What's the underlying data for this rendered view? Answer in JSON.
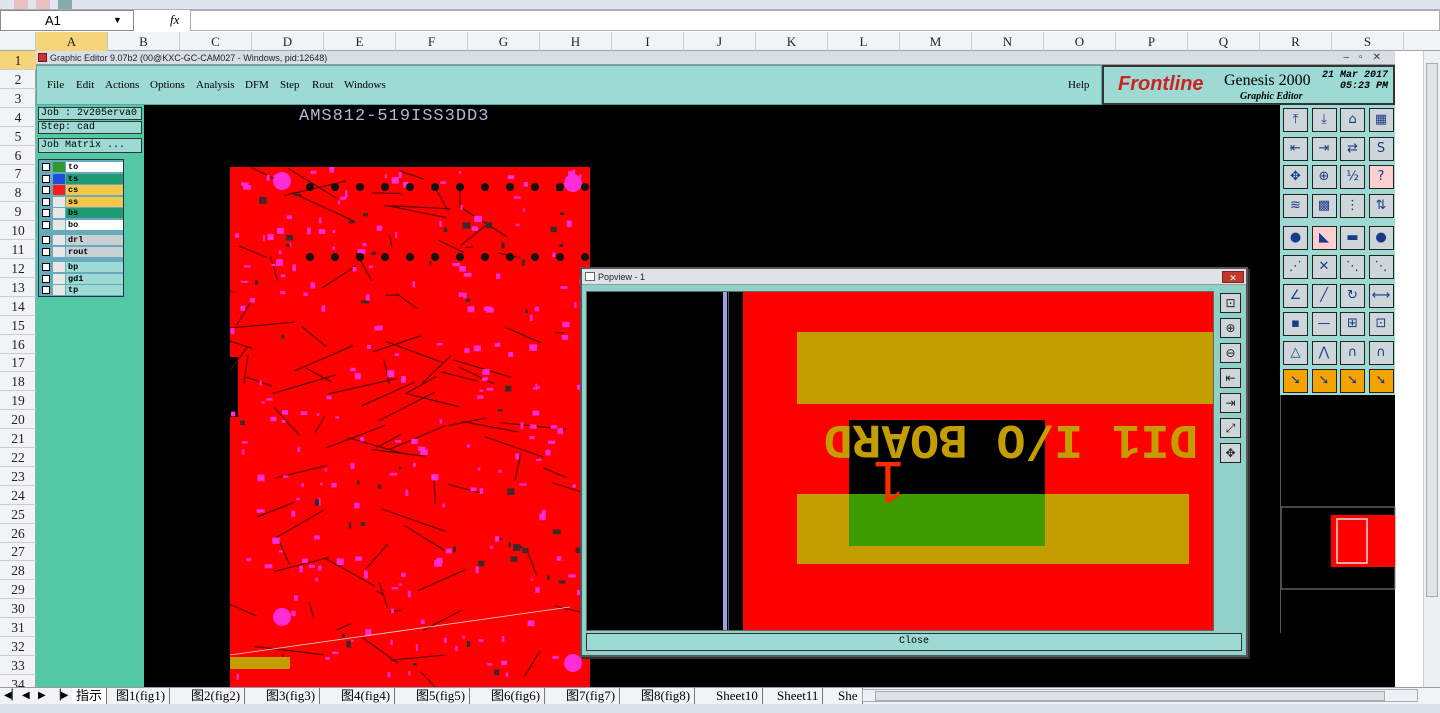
{
  "spreadsheet": {
    "name_box": "A1",
    "formula_symbol": "fx",
    "columns": [
      "A",
      "B",
      "C",
      "D",
      "E",
      "F",
      "G",
      "H",
      "I",
      "J",
      "K",
      "L",
      "M",
      "N",
      "O",
      "P",
      "Q",
      "R",
      "S"
    ],
    "rows": [
      "1",
      "2",
      "3",
      "4",
      "5",
      "6",
      "7",
      "8",
      "9",
      "10",
      "11",
      "12",
      "13",
      "14",
      "15",
      "16",
      "17",
      "18",
      "19",
      "20",
      "21",
      "22",
      "23",
      "24",
      "25",
      "26",
      "27",
      "28",
      "29",
      "30",
      "31",
      "32",
      "33",
      "34"
    ],
    "sheet_tabs": [
      "指示",
      "图1(fig1)",
      "图2(fig2)",
      "图3(fig3)",
      "图4(fig4)",
      "图5(fig5)",
      "图6(fig6)",
      "图7(fig7)",
      "图8(fig8)",
      "Sheet10",
      "Sheet11",
      "She"
    ]
  },
  "app": {
    "window_title": "Graphic Editor 9.07b2 (00@KXC-GC-CAM027 - Windows, pid:12648)",
    "menus": [
      "File",
      "Edit",
      "Actions",
      "Options",
      "Analysis",
      "DFM",
      "Step",
      "Rout",
      "Windows"
    ],
    "help": "Help",
    "brand": {
      "logo": "Frontline",
      "product": "Genesis 2000",
      "subtitle": "Graphic Editor",
      "date": "21 Mar 2017",
      "time": "05:23 PM"
    },
    "job_label": "Job : 2v205erva0",
    "step_label": "Step: cad",
    "job_matrix": "Job Matrix ...",
    "layers": [
      {
        "name": "to",
        "color": "#2e9a2e",
        "bg": "#ffffff"
      },
      {
        "name": "ts",
        "color": "#1f4fd6",
        "bg": "#1f9a73"
      },
      {
        "name": "cs",
        "color": "#ff1a1a",
        "bg": "#f3c84a"
      },
      {
        "name": "ss",
        "color": "#e7e7e7",
        "bg": "#f3c84a"
      },
      {
        "name": "bs",
        "color": "#e7e7e7",
        "bg": "#1f9a73"
      },
      {
        "name": "bo",
        "color": "#e7e7e7",
        "bg": "#ffffff"
      },
      {
        "name": "drl",
        "color": "#e7e7e7",
        "bg": "#c7d1d4"
      },
      {
        "name": "rout",
        "color": "#e7e7e7",
        "bg": "#c7d1d4"
      },
      {
        "name": "bp",
        "color": "#e7e7e7",
        "bg": "#9cdad3"
      },
      {
        "name": "gd1",
        "color": "#e7e7e7",
        "bg": "#9cdad3"
      },
      {
        "name": "tp",
        "color": "#e7e7e7",
        "bg": "#9cdad3"
      }
    ],
    "canvas_title": "AMS812-519ISS3DD3",
    "popview": {
      "title": "Popview - 1",
      "silk_text": "DI1 I/O BOARD",
      "pad_number": "1",
      "close_label": "Close"
    },
    "colors": {
      "copper": "#ff0000",
      "pad": "#ff2dd8",
      "silk": "#c49d00",
      "panel_teal": "#9cdad3",
      "panel_green": "#52c8a4"
    }
  }
}
